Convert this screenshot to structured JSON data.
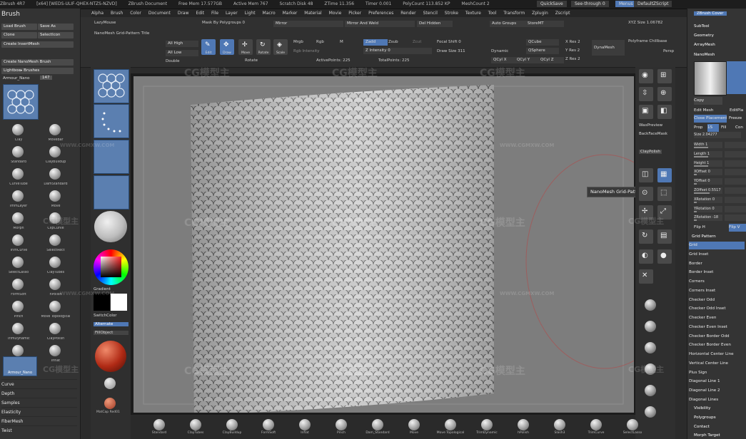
{
  "title_bar": {
    "segments": [
      "ZBrush 4R7",
      "[x64] [WEDS-ULIF-QHEX-NTZS-NZVD]",
      "ZBrush Document",
      "Free Mem 17.577GB",
      "Active Mem 767",
      "Scratch Disk 48",
      "ZTime 11.356",
      "Timer 0.001",
      "PolyCount 113.852 KP",
      "MeshCount 2"
    ],
    "quicksave": "QuickSave",
    "seethrough": "See-through 0",
    "menus_btn": "Menus",
    "default_script": "DefaultZScript"
  },
  "menubar": [
    "Alpha",
    "Brush",
    "Color",
    "Document",
    "Draw",
    "Edit",
    "File",
    "Layer",
    "Light",
    "Macro",
    "Marker",
    "Material",
    "Movie",
    "Picker",
    "Preferences",
    "Render",
    "Stencil",
    "Stroke",
    "Texture",
    "Tool",
    "Transform",
    "Zplugin",
    "Zscript"
  ],
  "left_panel": {
    "title": "Brush",
    "buttons": [
      "Load Brush",
      "Save As",
      "Clone",
      "SelectIcon",
      "Create InsertMesh",
      "Create NanoMesh Brush",
      "Lightbox▸ Brushes"
    ],
    "brush_slot_label": "Armour_Nano",
    "brush_slot_value": "147",
    "current_brush": "Armour_Nano",
    "brushes": [
      "Clay",
      "MoveBar",
      "Standard",
      "ClayBuildup",
      "CurveTube",
      "DamStandard",
      "ImmLayer",
      "Move",
      "Morph",
      "ClipCurve",
      "TrimCurve",
      "SelectRect",
      "SelectLasso",
      "ClayTubes",
      "FormSoft",
      "hPolish",
      "Pinch",
      "Move Topological",
      "TrimDynamic",
      "ClayPolish",
      "Slash3",
      "Inflat",
      "Armour_RBB",
      "Armour_Nano",
      "Smooth"
    ],
    "list": [
      "Curve",
      "Depth",
      "Samples",
      "Elasticity",
      "FiberMesh",
      "Twist"
    ]
  },
  "top_bar": {
    "lazymouse": "LazyMouse",
    "nanomesh_title": "NanoMesh Grid-Pattern Title",
    "hmode_label": "Mask By Polygroups 0",
    "all_high": "All High",
    "all_low": "All Low",
    "double": "Double",
    "tools": [
      {
        "glyph": "✎",
        "label": "Edit",
        "active": true
      },
      {
        "glyph": "✥",
        "label": "Draw",
        "active": true
      },
      {
        "glyph": "✢",
        "label": "Move",
        "active": false
      },
      {
        "glyph": "◈",
        "label": "Scale",
        "active": false
      },
      {
        "glyph": "↻",
        "label": "Rotate",
        "active": false
      }
    ],
    "mirror": "Mirror",
    "mirror_weld": "Mirror And Weld",
    "del_hidden": "Del Hidden",
    "auto_groups": "Auto Groups",
    "storeMT": "StoreMT",
    "mrgb": "Mrgb",
    "rgb": "Rgb",
    "m": "M",
    "zadd": "Zadd",
    "zsub": "Zsub",
    "zcut": "Zcut",
    "rgb_intensity": "Rgb Intensity",
    "z_intensity": "Z Intensity 0",
    "draw_size": "Draw Size 311",
    "focal_shift": "Focal Shift 0",
    "active_points": "ActivePoints: 225",
    "total_points": "TotalPoints: 225",
    "dynamic": "Dynamic",
    "dynamesh": "DynaMesh",
    "qcube": "QCube",
    "qsphere": "QSphere",
    "qcyl_x": "QCyl X",
    "qcyl_y": "QCyl Y",
    "qcyl_z": "QCyl Z",
    "xres": "X Res 2",
    "yres": "Y Res 2",
    "zres": "Z Res 2",
    "xyz_size": "XYZ Size 1.06782",
    "polyframe": "Polyframe Chillbase",
    "persp": "Persp",
    "floor": "Floor",
    "local": "Local",
    "rotate": "Rotate"
  },
  "left_shelf": {
    "gradient": "Gradient",
    "switch_color": "SwitchColor",
    "alternate": "Alternate",
    "fillobject": "FillObject",
    "material_label": "MatCap Red01"
  },
  "right_shelf": {
    "items": [
      "BPR",
      "SPix 3",
      "Scroll",
      "Zoom",
      "Actual",
      "AAHalf",
      "Persp",
      "Floor",
      "Local",
      "Frame",
      "Move",
      "Scale",
      "Rotate",
      "PolyF",
      "Transp",
      "Solo",
      "Xpose"
    ],
    "waxpreview": "WaxPreview",
    "backfacemask": "BackFaceMask",
    "claypolish": "ClayPolish"
  },
  "tooltip": "NanoMesh Grid-Pattern Title",
  "right_panel": {
    "top": "ZBrush Cover",
    "subtool": "SubTool",
    "geometry": "Geometry",
    "arraymesh": "ArrayMesh",
    "nanomesh": "NanoMesh",
    "copy": "Copy",
    "edit_mesh": "Edit Mesh",
    "edit_placement": "EditPla",
    "close_placement": "Close Placement",
    "freeze": "Freeze",
    "prop": "Prop",
    "prop_vals": [
      "1S",
      "Fill",
      "Con"
    ],
    "size": "Size 2.04277",
    "sliders": [
      {
        "label": "Width 1",
        "value": 0.5
      },
      {
        "label": "Length 1",
        "value": 0.5
      },
      {
        "label": "Height 1",
        "value": 0.5
      },
      {
        "label": "XOffset 0",
        "value": 0.0
      },
      {
        "label": "YOffset 0",
        "value": 0.0
      },
      {
        "label": "ZOffset 0.5517",
        "value": 0.55
      },
      {
        "label": "XRotation 0",
        "value": 0.0
      },
      {
        "label": "YRotation 0",
        "value": 0.0
      },
      {
        "label": "ZRotation -18",
        "value": 0.1
      }
    ],
    "flip_h": "Flip H",
    "flip_v": "Flip V",
    "grid_pattern": "Grid Pattern",
    "patterns": [
      {
        "label": "Grid",
        "selected": true
      },
      {
        "label": "Grid Inset",
        "selected": false
      },
      {
        "label": "Border",
        "selected": false
      },
      {
        "label": "Border Inset",
        "selected": false
      },
      {
        "label": "Corners",
        "selected": false
      },
      {
        "label": "Corners Inset",
        "selected": false
      },
      {
        "label": "Checker Odd",
        "selected": false
      },
      {
        "label": "Checker Odd Inset",
        "selected": false
      },
      {
        "label": "Checker Even",
        "selected": false
      },
      {
        "label": "Checker Even Inset",
        "selected": false
      },
      {
        "label": "Checker Border Odd",
        "selected": false
      },
      {
        "label": "Checker Border Even",
        "selected": false
      },
      {
        "label": "Horizontal Center Line",
        "selected": false
      },
      {
        "label": "Vertical Center Line",
        "selected": false
      },
      {
        "label": "Plus Sign",
        "selected": false
      },
      {
        "label": "Diagonal Line 1",
        "selected": false
      },
      {
        "label": "Diagonal Line 2",
        "selected": false
      },
      {
        "label": "Diagonal Lines",
        "selected": false
      }
    ],
    "visibility": "Visibility",
    "polygroups": "Polygroups",
    "contact": "Contact",
    "morph_target": "Morph Target"
  },
  "bottom_shelf": [
    "Standard",
    "ClayTubes",
    "ClayBuildup",
    "FormSoft",
    "Inflat",
    "Pinch",
    "Dam_Standard",
    "Move",
    "Move Topological",
    "TrimDynamic",
    "hPolish",
    "Slash3",
    "TrimCurve",
    "SelectLasso"
  ],
  "watermark": "CG模型主",
  "watermark_url": "WWW.CGMXW.COM"
}
